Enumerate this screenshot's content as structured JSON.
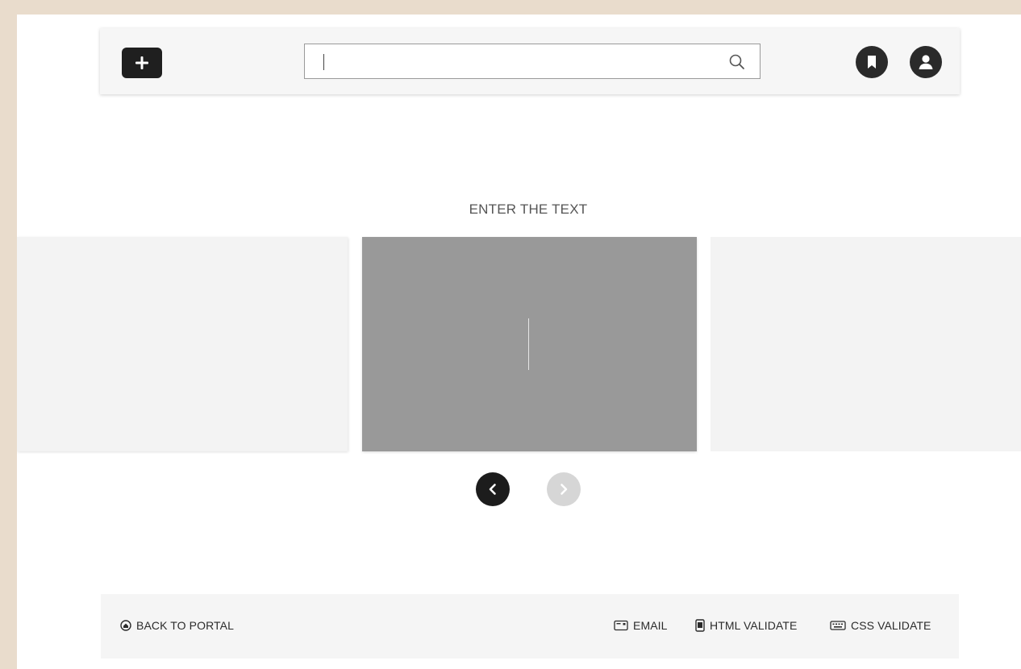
{
  "header": {
    "add_icon": "plus-icon",
    "search": {
      "value": "",
      "placeholder": "",
      "icon": "search-icon"
    },
    "bookmark_icon": "bookmark-icon",
    "profile_icon": "user-icon"
  },
  "carousel": {
    "title": "ENTER THE TEXT",
    "prev_icon": "chevron-left-icon",
    "next_icon": "chevron-right-icon"
  },
  "footer": {
    "back_label": "BACK TO PORTAL",
    "email_label": "EMAIL",
    "html_label": "HTML VALIDATE",
    "css_label": "CSS VALIDATE"
  },
  "colors": {
    "frame": "#e9dccc",
    "dark": "#1f1f1f",
    "slide_active": "#999999",
    "slide_inactive": "#f3f3f3",
    "nav_disabled": "#d6d6d6"
  }
}
